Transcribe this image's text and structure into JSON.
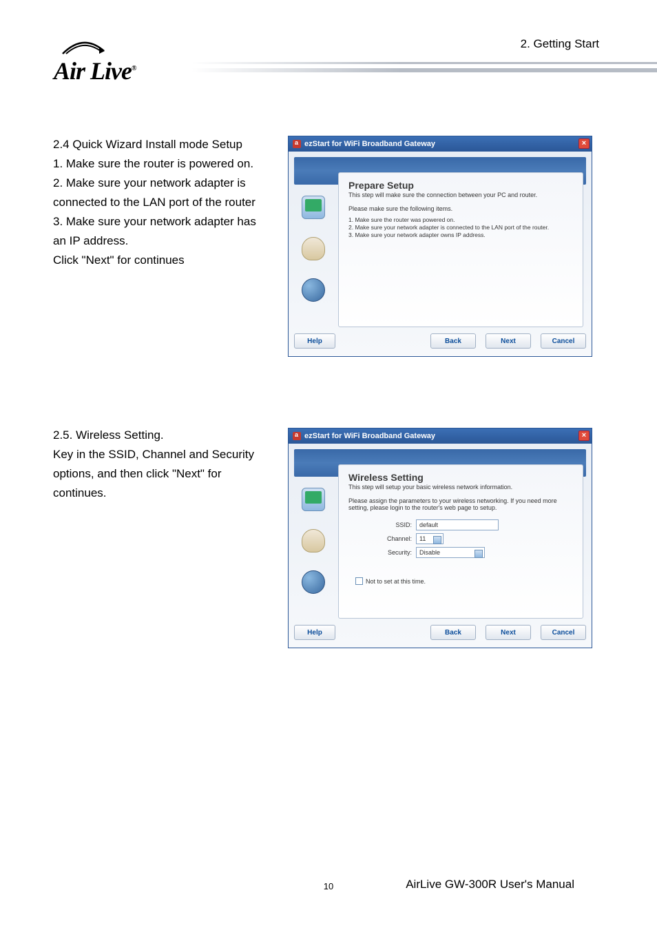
{
  "header": {
    "chapter": "2. Getting Start"
  },
  "logo": {
    "text": "Air Live",
    "reg": "®"
  },
  "section24": {
    "heading": "2.4  Quick Wizard Install mode Setup",
    "line1": "1. Make sure the router is powered on.",
    "line2": "2. Make sure your network adapter is connected to the LAN port of the router",
    "line3": "3. Make sure your network adapter has an IP address.",
    "line4": "Click \"Next\" for continues"
  },
  "section25": {
    "heading": "2.5.  Wireless Setting.",
    "body": "Key in the SSID, Channel and Security options, and then click \"Next\" for continues."
  },
  "dialog1": {
    "title": "ezStart for WiFi Broadband Gateway",
    "heading": "Prepare Setup",
    "sub": "This step will make sure the connection between your PC and router.",
    "p1": "Please make sure the following items.",
    "li1": "1. Make sure the router was powered on.",
    "li2": "2. Make sure your network adapter is connected to the LAN port of the router.",
    "li3": "3. Make sure your network adapter owns IP address.",
    "btn_help": "Help",
    "btn_back": "Back",
    "btn_next": "Next",
    "btn_cancel": "Cancel"
  },
  "dialog2": {
    "title": "ezStart for WiFi Broadband Gateway",
    "heading": "Wireless Setting",
    "sub": "This step will setup your basic wireless network information.",
    "p1": "Please assign the parameters to your wireless networking. If you need more setting, please login to the router's web page to setup.",
    "lbl_ssid": "SSID:",
    "val_ssid": "default",
    "lbl_channel": "Channel:",
    "val_channel": "11",
    "lbl_security": "Security:",
    "val_security": "Disable",
    "chk_label": "Not to set at this time.",
    "btn_help": "Help",
    "btn_back": "Back",
    "btn_next": "Next",
    "btn_cancel": "Cancel"
  },
  "footer": {
    "page": "10",
    "manual": "AirLive GW-300R User's Manual"
  }
}
